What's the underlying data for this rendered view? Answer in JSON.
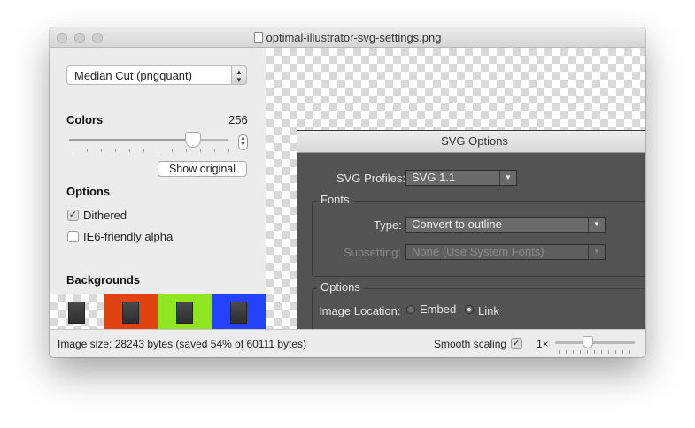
{
  "window": {
    "title": "optimal-illustrator-svg-settings.png"
  },
  "sidebar": {
    "algorithm": "Median Cut (pngquant)",
    "colors_label": "Colors",
    "colors_value": "256",
    "colors_fraction": 0.81,
    "show_original": "Show original",
    "options_label": "Options",
    "dithered_label": "Dithered",
    "dithered_checked": true,
    "ie6_label": "IE6-friendly alpha",
    "ie6_checked": false,
    "backgrounds_label": "Backgrounds",
    "backgrounds": [
      "checkerboard",
      "#e0430f",
      "#8fe520",
      "#2342ff"
    ]
  },
  "dialog": {
    "title": "SVG Options",
    "profiles_label": "SVG Profiles:",
    "profiles_value": "SVG 1.1",
    "fonts_group": "Fonts",
    "type_label": "Type:",
    "type_value": "Convert to outline",
    "subsetting_label": "Subsetting:",
    "subsetting_value": "None (Use System Fonts)",
    "options_group": "Options",
    "image_location_label": "Image Location:",
    "embed_label": "Embed",
    "link_label": "Link",
    "selected_location": "Link"
  },
  "status": {
    "image_size": "Image size: 28243 bytes (saved 54% of 60111 bytes)",
    "smooth_label": "Smooth scaling",
    "smooth_checked": true,
    "zoom_label": "1×",
    "zoom_fraction": 0.4
  }
}
